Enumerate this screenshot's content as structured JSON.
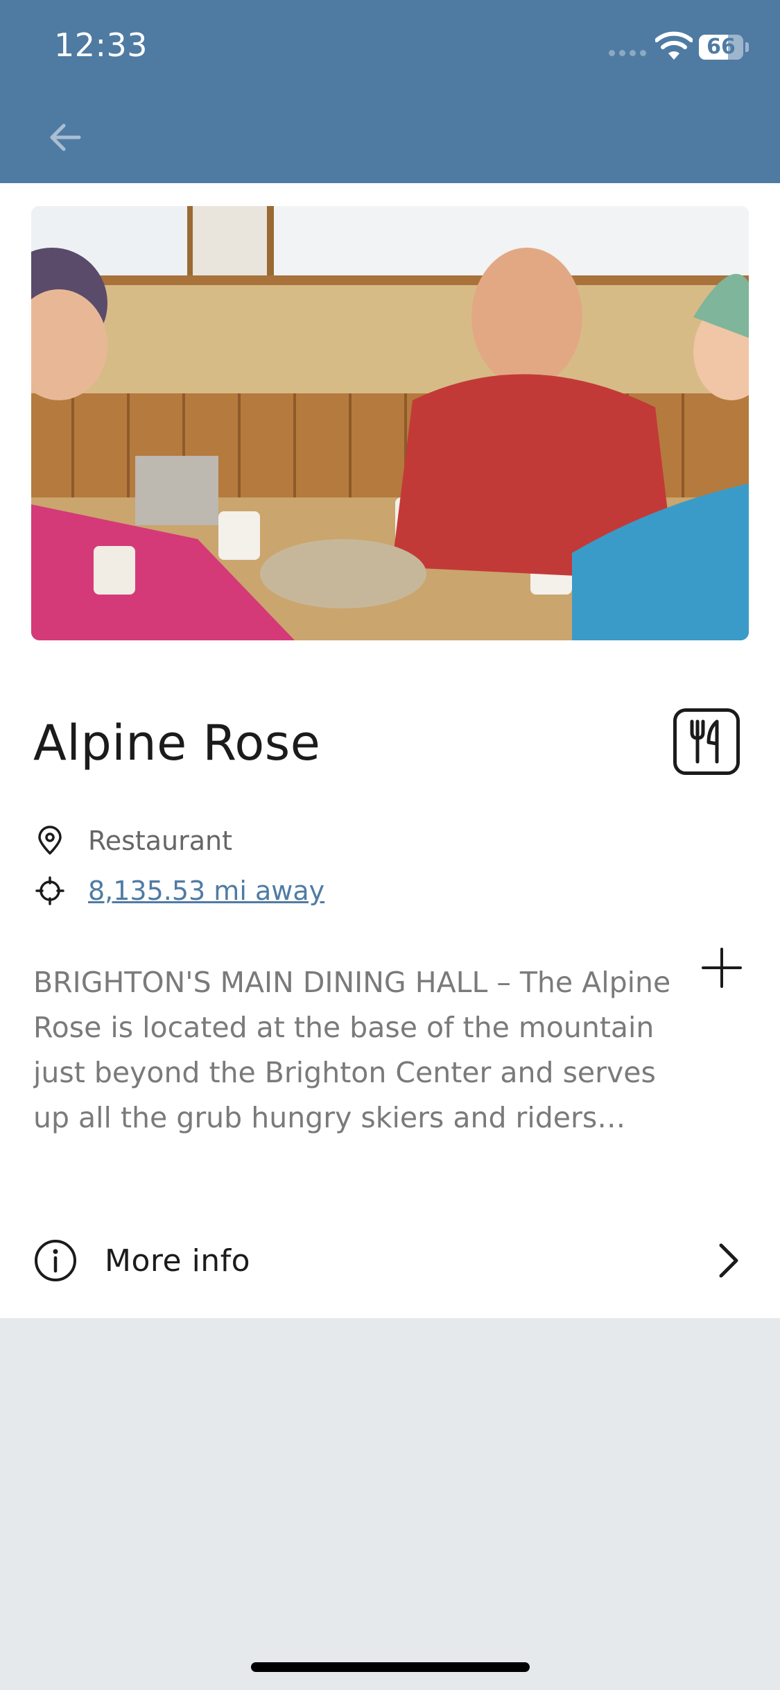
{
  "status_bar": {
    "time": "12:33",
    "battery": "66",
    "battery_level": 0.66
  },
  "header": {
    "back_icon": "arrow-left-icon"
  },
  "place": {
    "name": "Alpine Rose",
    "category_icon": "fork-knife-icon",
    "type": "Restaurant",
    "distance": "8,135.53 mi away",
    "description": "BRIGHTON'S MAIN DINING HALL – The Alpine Rose is located at the base of the mountain just beyond the Brighton Center and serves up all the grub hungry skiers and riders crave at the base of the mountain."
  },
  "actions": {
    "more_info": "More info"
  },
  "colors": {
    "header": "#4f7ba3",
    "link": "#4f7ba3",
    "background": "#e6e9eb"
  }
}
